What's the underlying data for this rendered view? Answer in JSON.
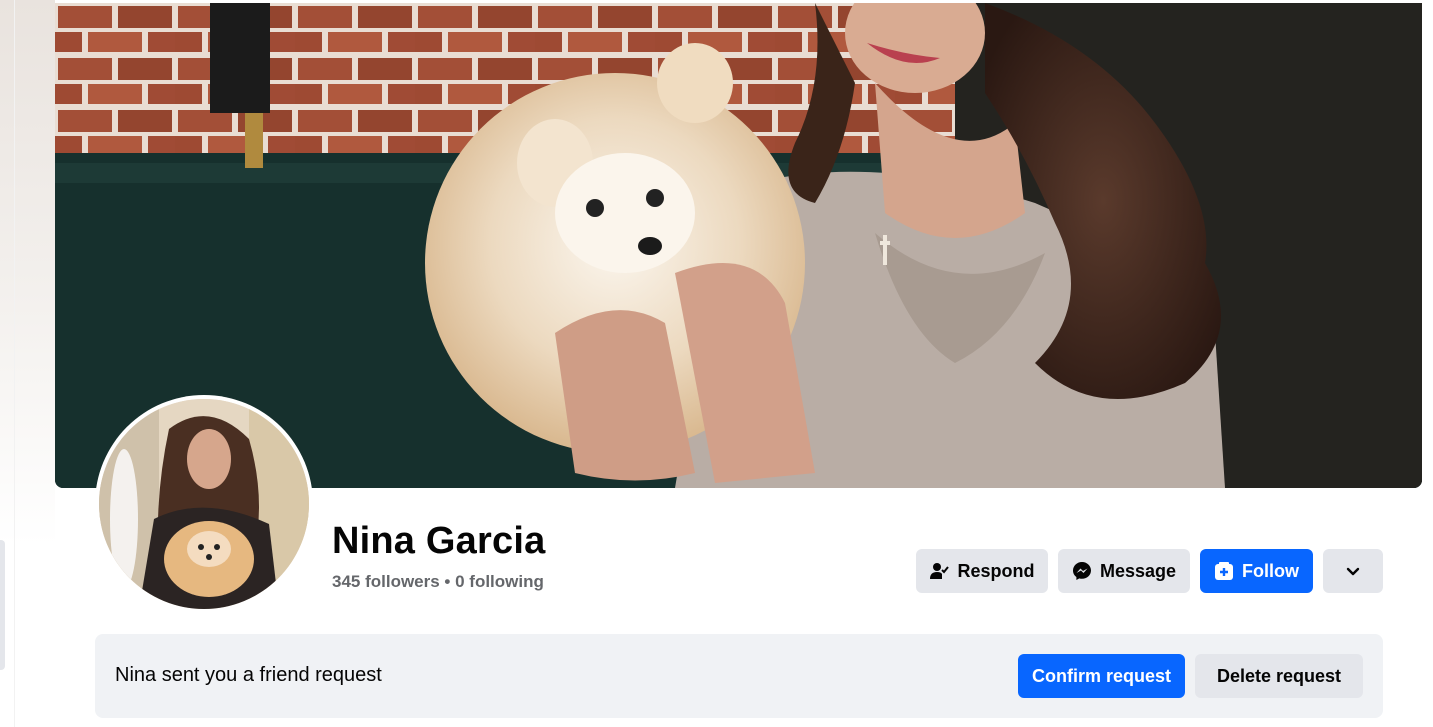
{
  "profile": {
    "name": "Nina Garcia",
    "stats": "345 followers • 0 following"
  },
  "actions": {
    "respond_label": "Respond",
    "message_label": "Message",
    "follow_label": "Follow",
    "more_icon": "chevron-down-icon"
  },
  "friend_request": {
    "text": "Nina sent you a friend request",
    "confirm_label": "Confirm request",
    "delete_label": "Delete request"
  },
  "colors": {
    "primary_blue": "#0866ff",
    "secondary_gray": "#e4e6eb",
    "request_bg": "#f0f2f5",
    "muted_text": "#65676b"
  }
}
